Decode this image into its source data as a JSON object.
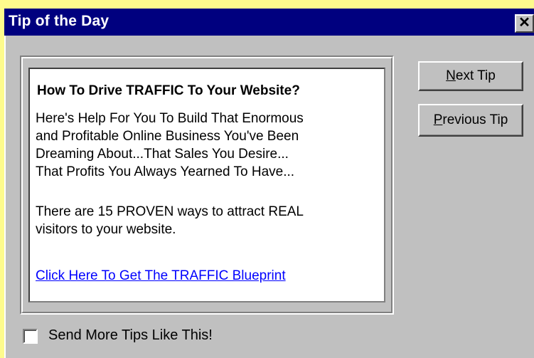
{
  "window": {
    "title": "Tip of the Day",
    "close_glyph": "✕"
  },
  "tip": {
    "heading": "How To Drive TRAFFIC To Your Website?",
    "body_lines": [
      "Here's Help For You To Build That Enormous",
      "and Profitable Online Business You've Been",
      "Dreaming About...That Sales You Desire...",
      "That Profits You Always Yearned To Have..."
    ],
    "body2_lines": [
      "There are 15 PROVEN ways to attract REAL",
      "visitors to your website."
    ],
    "link_text": "Click Here To Get The TRAFFIC Blueprint"
  },
  "buttons": {
    "next_mnemonic": "N",
    "next_rest": "ext Tip",
    "prev_mnemonic": "P",
    "prev_rest": "revious Tip"
  },
  "checkbox": {
    "label": "Send More Tips Like This!",
    "checked": false
  },
  "colors": {
    "titlebar": "#00007f",
    "face": "#c0c0c0",
    "link": "#0000ff",
    "background": "#fefb8d"
  }
}
